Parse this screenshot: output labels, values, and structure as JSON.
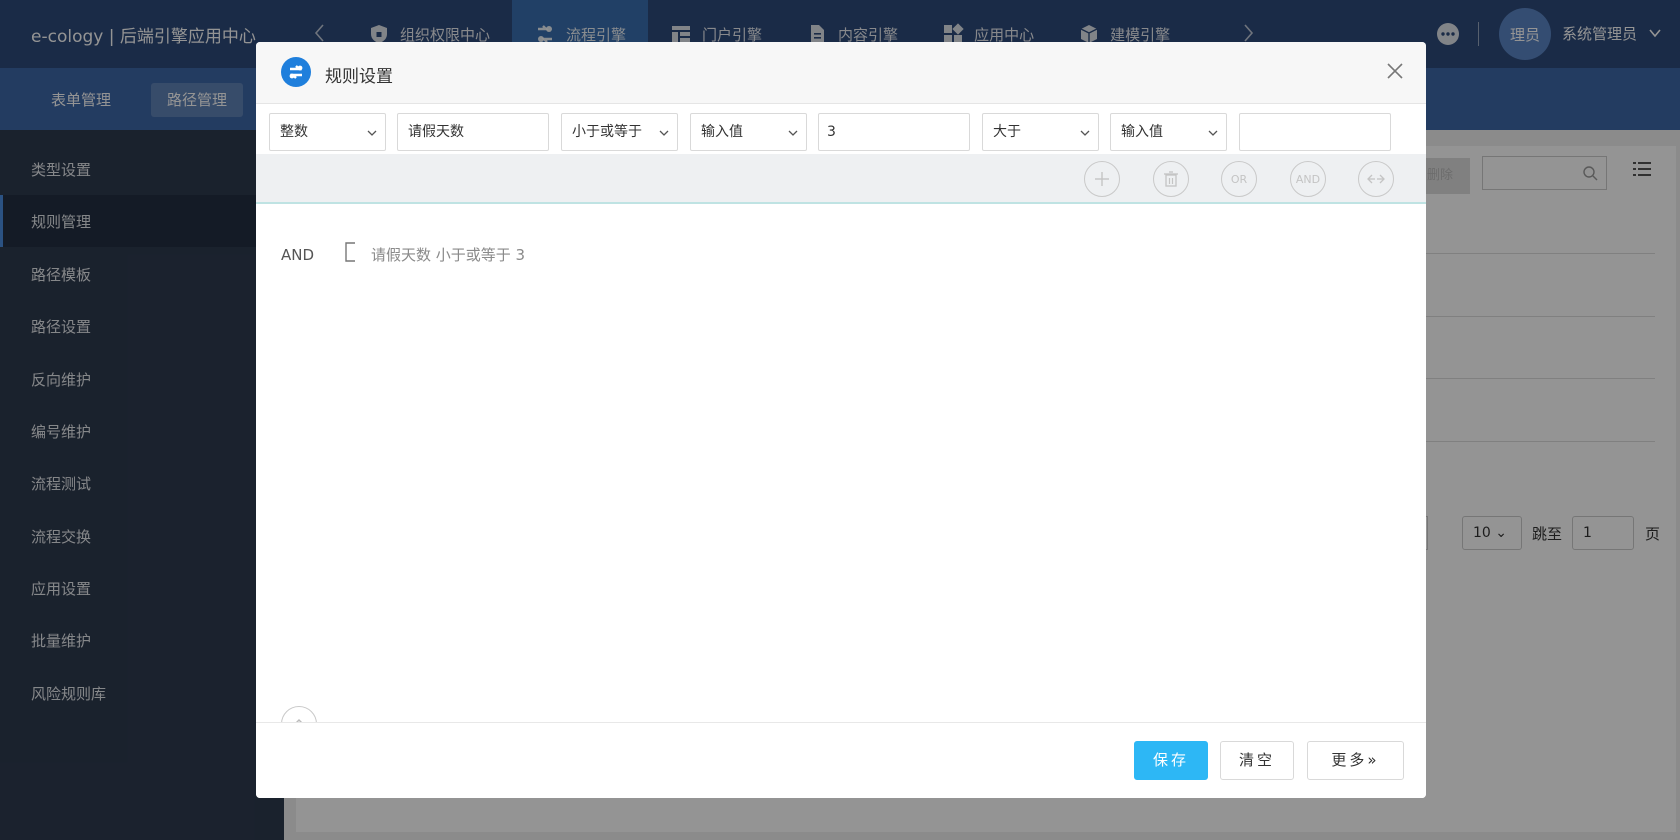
{
  "header": {
    "app_title": "e-cology | 后端引擎应用中心",
    "nav_items": [
      {
        "label": "组织权限中心",
        "icon": "shield-lock-icon",
        "active": false
      },
      {
        "label": "流程引擎",
        "icon": "workflow-icon",
        "active": true
      },
      {
        "label": "门户引擎",
        "icon": "layout-icon",
        "active": false
      },
      {
        "label": "内容引擎",
        "icon": "document-icon",
        "active": false
      },
      {
        "label": "应用中心",
        "icon": "apps-icon",
        "active": false
      },
      {
        "label": "建模引擎",
        "icon": "cube-icon",
        "active": false
      }
    ],
    "avatar_text": "理员",
    "user_name": "系统管理员"
  },
  "subnav": {
    "tabs": [
      {
        "label": "表单管理",
        "active": false
      },
      {
        "label": "路径管理",
        "active": true
      }
    ]
  },
  "sidebar": {
    "items": [
      {
        "label": "类型设置",
        "active": false,
        "has_children": false
      },
      {
        "label": "规则管理",
        "active": true,
        "has_children": false
      },
      {
        "label": "路径模板",
        "active": false,
        "has_children": false
      },
      {
        "label": "路径设置",
        "active": false,
        "has_children": false
      },
      {
        "label": "反向维护",
        "active": false,
        "has_children": false
      },
      {
        "label": "编号维护",
        "active": false,
        "has_children": true
      },
      {
        "label": "流程测试",
        "active": false,
        "has_children": true
      },
      {
        "label": "流程交换",
        "active": false,
        "has_children": false
      },
      {
        "label": "应用设置",
        "active": false,
        "has_children": false
      },
      {
        "label": "批量维护",
        "active": false,
        "has_children": false
      },
      {
        "label": "风险规则库",
        "active": false,
        "has_children": false
      }
    ]
  },
  "background": {
    "delete_label": "删除",
    "page_size": "10",
    "jump_label": "跳至",
    "jump_value": "1",
    "page_label": "页"
  },
  "dialog": {
    "title": "规则设置",
    "condition": {
      "field_type": "整数",
      "field_name": "请假天数",
      "operator1": "小于或等于",
      "value_type1": "输入值",
      "value1": "3",
      "operator2": "大于",
      "value_type2": "输入值",
      "value2": ""
    },
    "tools": {
      "or_label": "OR",
      "and_label": "AND"
    },
    "rule": {
      "operator": "AND",
      "expression": "请假天数 小于或等于 3"
    },
    "footer": {
      "save_label": "保存",
      "clear_label": "清空",
      "more_label": "更多"
    }
  }
}
